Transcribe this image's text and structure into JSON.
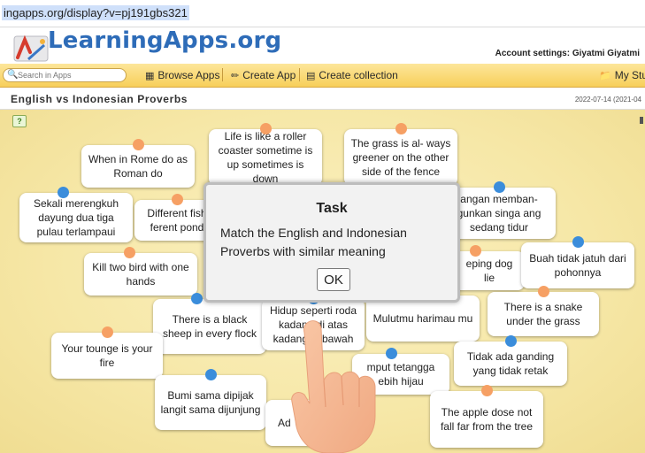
{
  "browser": {
    "url": "ingapps.org/display?v=pj191gbs321"
  },
  "header": {
    "logo_text": "LearningApps.org",
    "account_settings": "Account settings: Giyatmi Giyatmi"
  },
  "nav": {
    "search_placeholder": "Search in Apps",
    "browse_apps": "Browse Apps",
    "create_app": "Create App",
    "create_collection": "Create collection",
    "my_stuff": "My Stuf"
  },
  "app": {
    "title": "English vs Indonesian Proverbs",
    "date": "2022-07-14 (2021-04"
  },
  "cards": [
    {
      "text": "When in Rome do as Roman do",
      "pin": "orange"
    },
    {
      "text": "Life is like a roller coaster sometime is up sometimes is down",
      "pin": "orange"
    },
    {
      "text": "The grass is al- ways greener on the other side of the fence",
      "pin": "orange"
    },
    {
      "text": "Sekali merengkuh dayung dua tiga pulau terlampaui",
      "pin": "blue"
    },
    {
      "text": "Different fish ferent pond",
      "pin": "orange"
    },
    {
      "text": "angan memban- gunkan singa ang sedang tidur",
      "pin": "blue"
    },
    {
      "text": "Kill two bird with one hands",
      "pin": "orange"
    },
    {
      "text": "eping dog lie",
      "pin": "orange"
    },
    {
      "text": "Buah tidak jatuh dari pohonnya",
      "pin": "blue"
    },
    {
      "text": "There is a black sheep in every flock",
      "pin": "blue"
    },
    {
      "text": "Hidup seperti roda kadang di atas kadang di bawah",
      "pin": "blue"
    },
    {
      "text": "Mulutmu harimau mu",
      "pin": "blue"
    },
    {
      "text": "There is a snake under the grass",
      "pin": "orange"
    },
    {
      "text": "Your tounge is your fire",
      "pin": "orange"
    },
    {
      "text": "Tidak ada ganding yang tidak retak",
      "pin": "blue"
    },
    {
      "text": "mput tetangga ebih hijau",
      "pin": "blue"
    },
    {
      "text": "Bumi sama dipijak langit sama dijunjung",
      "pin": "blue"
    },
    {
      "text": "Ad",
      "pin": "blue"
    },
    {
      "text": "The apple dose not fall far from the tree",
      "pin": "orange"
    }
  ],
  "dialog": {
    "title": "Task",
    "message": "Match the English and Indonesian Proverbs with similar meaning",
    "ok_label": "OK"
  },
  "colors": {
    "logo_blue": "#2e6cb8",
    "nav_bar": "#f7cf5a",
    "pin_orange": "#f6a064",
    "pin_blue": "#3b8ddb",
    "board_background": "#f6e7a6"
  }
}
